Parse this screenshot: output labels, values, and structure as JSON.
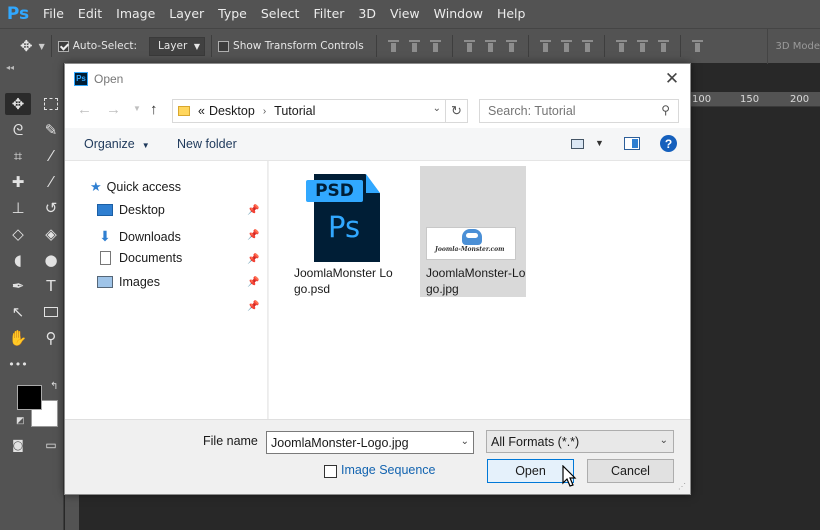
{
  "photoshop": {
    "logo": "Ps",
    "menu": [
      "File",
      "Edit",
      "Image",
      "Layer",
      "Type",
      "Select",
      "Filter",
      "3D",
      "View",
      "Window",
      "Help"
    ],
    "options": {
      "auto_select_label": "Auto-Select:",
      "auto_select_checked": true,
      "auto_select_target": "Layer",
      "show_transform_label": "Show Transform Controls",
      "show_transform_checked": false,
      "mode_3d_label": "3D Mode"
    },
    "ruler_ticks": [
      "100",
      "150",
      "200"
    ],
    "tools": [
      "move-tool",
      "marquee-tool",
      "lasso-tool",
      "quick-select-tool",
      "crop-tool",
      "eyedropper-tool",
      "healing-brush-tool",
      "brush-tool",
      "clone-stamp-tool",
      "history-brush-tool",
      "eraser-tool",
      "paint-bucket-tool",
      "blur-tool",
      "dodge-tool",
      "pen-tool",
      "type-tool",
      "path-select-tool",
      "rectangle-tool",
      "hand-tool",
      "zoom-tool"
    ],
    "foreground_color": "#000000",
    "background_color": "#ffffff"
  },
  "dialog": {
    "title": "Open",
    "breadcrumb": [
      "«",
      "Desktop",
      "Tutorial"
    ],
    "search_placeholder": "Search: Tutorial",
    "organize_label": "Organize",
    "new_folder_label": "New folder",
    "nav": [
      {
        "label": "Quick access",
        "icon": "star-icon",
        "pinned": false
      },
      {
        "label": "Desktop",
        "icon": "desktop-icon",
        "pinned": true
      },
      {
        "label": "Downloads",
        "icon": "download-icon",
        "pinned": true
      },
      {
        "label": "Documents",
        "icon": "document-icon",
        "pinned": true
      },
      {
        "label": "Images",
        "icon": "images-icon",
        "pinned": true
      }
    ],
    "files": [
      {
        "name": "JoomlaMonster Logo.psd",
        "icon_band": "PSD",
        "icon_mark": "Ps",
        "selected": false
      },
      {
        "name": "JoomlaMonster-Logo.jpg",
        "thumb_text": "Joomla-Monster.com",
        "selected": true
      }
    ],
    "file_name_label": "File name",
    "file_name_value": "JoomlaMonster-Logo.jpg",
    "format_value": "All Formats (*.*)",
    "image_sequence_label": "Image Sequence",
    "image_sequence_checked": false,
    "open_label": "Open",
    "cancel_label": "Cancel",
    "accent": "#0078d7"
  }
}
